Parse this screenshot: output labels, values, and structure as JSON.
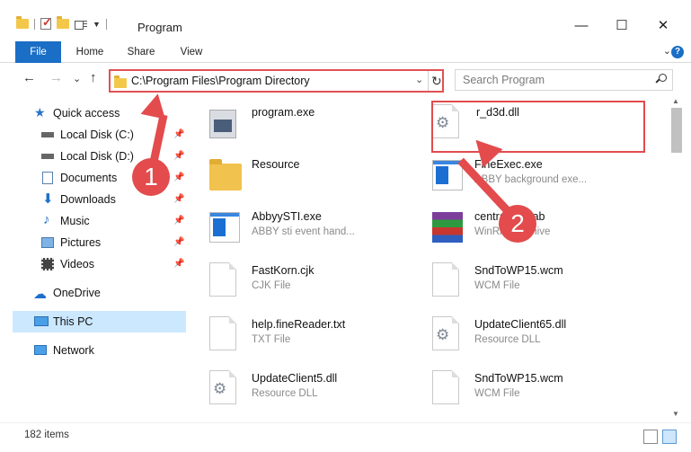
{
  "window": {
    "title": "Program",
    "minimize": "—",
    "maximize": "☐",
    "close": "✕"
  },
  "ribbon": {
    "tabs": [
      "File",
      "Home",
      "Share",
      "View"
    ],
    "expand": "⌄",
    "help": "?"
  },
  "nav": {
    "back": "←",
    "forward": "→",
    "recent": "⌄",
    "up": "↑",
    "address": "C:\\Program Files\\Program Directory",
    "address_dropdown": "⌄",
    "refresh": "↻",
    "search_placeholder": "Search Program"
  },
  "sidebar": {
    "items": [
      {
        "label": "Quick access",
        "icon": "star-icon",
        "pinned": false
      },
      {
        "label": "Local Disk (C:)",
        "icon": "drive-icon",
        "pinned": true
      },
      {
        "label": "Local Disk (D:)",
        "icon": "drive-icon",
        "pinned": true
      },
      {
        "label": "Documents",
        "icon": "documents-icon",
        "pinned": true
      },
      {
        "label": "Downloads",
        "icon": "download-icon",
        "pinned": true
      },
      {
        "label": "Music",
        "icon": "music-icon",
        "pinned": true
      },
      {
        "label": "Pictures",
        "icon": "pictures-icon",
        "pinned": true
      },
      {
        "label": "Videos",
        "icon": "videos-icon",
        "pinned": true
      },
      {
        "label": "OneDrive",
        "icon": "cloud-icon",
        "pinned": false
      },
      {
        "label": "This PC",
        "icon": "computer-icon",
        "pinned": false
      },
      {
        "label": "Network",
        "icon": "network-icon",
        "pinned": false
      }
    ],
    "pin_glyph": "📌"
  },
  "files": [
    {
      "name": "program.exe",
      "desc": "",
      "icon": "exe-gray-icon"
    },
    {
      "name": "r_d3d.dll",
      "desc": "",
      "icon": "dll-gear-icon"
    },
    {
      "name": "Resource",
      "desc": "",
      "icon": "folder-icon"
    },
    {
      "name": "FineExec.exe",
      "desc": "ABBY background exe...",
      "icon": "window-app-icon"
    },
    {
      "name": "AbbyySTI.exe",
      "desc": "ABBY sti event hand...",
      "icon": "window-app-icon"
    },
    {
      "name": "centralres.cab",
      "desc": "WinRAR archive",
      "icon": "archive-icon"
    },
    {
      "name": "FastKorn.cjk",
      "desc": "CJK File",
      "icon": "blank-file-icon"
    },
    {
      "name": "SndToWP15.wcm",
      "desc": "WCM File",
      "icon": "blank-file-icon"
    },
    {
      "name": "help.fineReader.txt",
      "desc": "TXT File",
      "icon": "blank-file-icon"
    },
    {
      "name": "UpdateClient65.dll",
      "desc": "Resource DLL",
      "icon": "dll-gear-icon"
    },
    {
      "name": "UpdateClient5.dll",
      "desc": "Resource DLL",
      "icon": "dll-gear-icon"
    },
    {
      "name": "SndToWP15.wcm",
      "desc": "WCM File",
      "icon": "blank-file-icon"
    }
  ],
  "annotations": {
    "step1": "1",
    "step2": "2",
    "color": "#e34b4d"
  },
  "status": {
    "item_count": "182 items"
  }
}
